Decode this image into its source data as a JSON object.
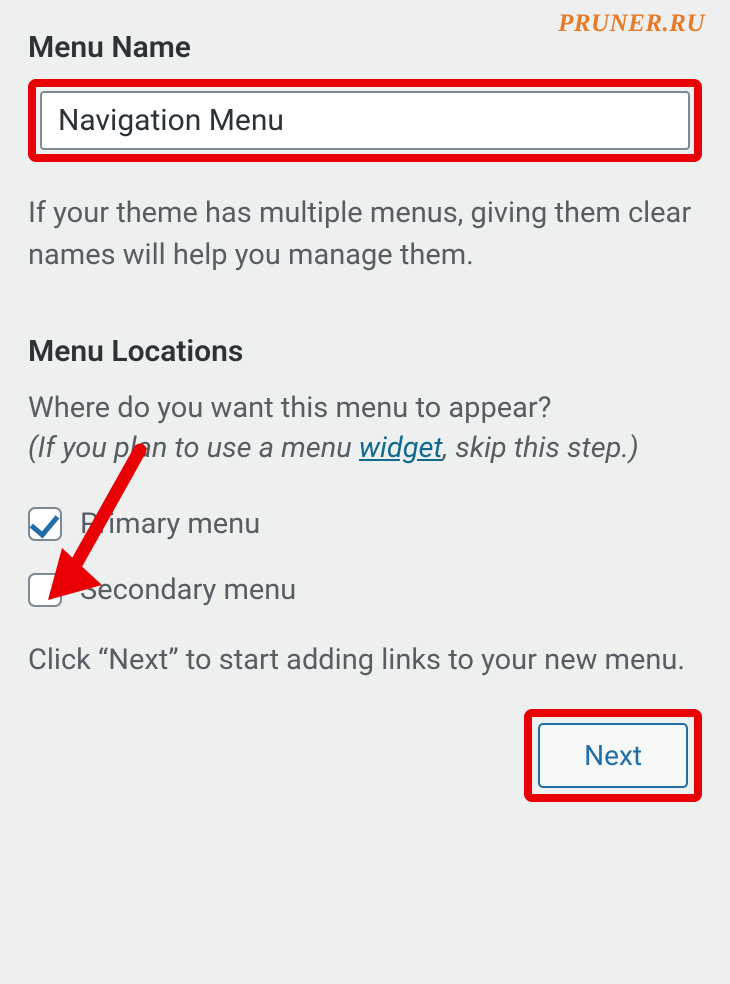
{
  "watermark": "PRUNER.RU",
  "menuName": {
    "heading": "Menu Name",
    "value": "Navigation Menu",
    "helpText": "If your theme has multiple menus, giving them clear names will help you manage them."
  },
  "locations": {
    "heading": "Menu Locations",
    "question": "Where do you want this menu to appear?",
    "hintPrefix": "(If you plan to use a menu ",
    "hintLink": "widget",
    "hintSuffix": ", skip this step.)",
    "options": [
      {
        "label": "Primary menu",
        "checked": true
      },
      {
        "label": "Secondary menu",
        "checked": false
      }
    ],
    "instruction": "Click “Next” to start adding links to your new menu."
  },
  "nextButton": "Next",
  "colors": {
    "highlight": "#e90005",
    "accent": "#1f6ea8"
  }
}
